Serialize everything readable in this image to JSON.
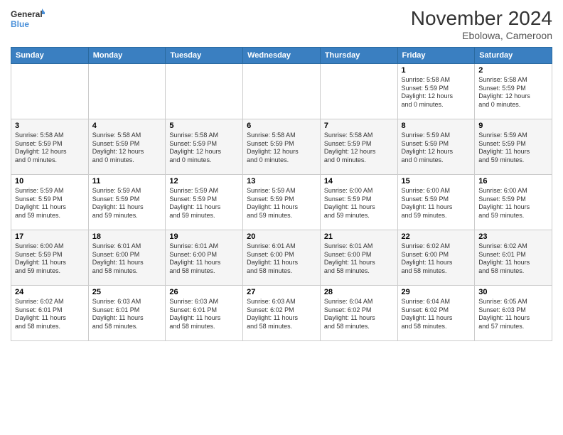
{
  "logo": {
    "line1": "General",
    "line2": "Blue"
  },
  "title": "November 2024",
  "subtitle": "Ebolowa, Cameroon",
  "days_header": [
    "Sunday",
    "Monday",
    "Tuesday",
    "Wednesday",
    "Thursday",
    "Friday",
    "Saturday"
  ],
  "weeks": [
    [
      {
        "day": "",
        "info": ""
      },
      {
        "day": "",
        "info": ""
      },
      {
        "day": "",
        "info": ""
      },
      {
        "day": "",
        "info": ""
      },
      {
        "day": "",
        "info": ""
      },
      {
        "day": "1",
        "info": "Sunrise: 5:58 AM\nSunset: 5:59 PM\nDaylight: 12 hours\nand 0 minutes."
      },
      {
        "day": "2",
        "info": "Sunrise: 5:58 AM\nSunset: 5:59 PM\nDaylight: 12 hours\nand 0 minutes."
      }
    ],
    [
      {
        "day": "3",
        "info": "Sunrise: 5:58 AM\nSunset: 5:59 PM\nDaylight: 12 hours\nand 0 minutes."
      },
      {
        "day": "4",
        "info": "Sunrise: 5:58 AM\nSunset: 5:59 PM\nDaylight: 12 hours\nand 0 minutes."
      },
      {
        "day": "5",
        "info": "Sunrise: 5:58 AM\nSunset: 5:59 PM\nDaylight: 12 hours\nand 0 minutes."
      },
      {
        "day": "6",
        "info": "Sunrise: 5:58 AM\nSunset: 5:59 PM\nDaylight: 12 hours\nand 0 minutes."
      },
      {
        "day": "7",
        "info": "Sunrise: 5:58 AM\nSunset: 5:59 PM\nDaylight: 12 hours\nand 0 minutes."
      },
      {
        "day": "8",
        "info": "Sunrise: 5:59 AM\nSunset: 5:59 PM\nDaylight: 12 hours\nand 0 minutes."
      },
      {
        "day": "9",
        "info": "Sunrise: 5:59 AM\nSunset: 5:59 PM\nDaylight: 11 hours\nand 59 minutes."
      }
    ],
    [
      {
        "day": "10",
        "info": "Sunrise: 5:59 AM\nSunset: 5:59 PM\nDaylight: 11 hours\nand 59 minutes."
      },
      {
        "day": "11",
        "info": "Sunrise: 5:59 AM\nSunset: 5:59 PM\nDaylight: 11 hours\nand 59 minutes."
      },
      {
        "day": "12",
        "info": "Sunrise: 5:59 AM\nSunset: 5:59 PM\nDaylight: 11 hours\nand 59 minutes."
      },
      {
        "day": "13",
        "info": "Sunrise: 5:59 AM\nSunset: 5:59 PM\nDaylight: 11 hours\nand 59 minutes."
      },
      {
        "day": "14",
        "info": "Sunrise: 6:00 AM\nSunset: 5:59 PM\nDaylight: 11 hours\nand 59 minutes."
      },
      {
        "day": "15",
        "info": "Sunrise: 6:00 AM\nSunset: 5:59 PM\nDaylight: 11 hours\nand 59 minutes."
      },
      {
        "day": "16",
        "info": "Sunrise: 6:00 AM\nSunset: 5:59 PM\nDaylight: 11 hours\nand 59 minutes."
      }
    ],
    [
      {
        "day": "17",
        "info": "Sunrise: 6:00 AM\nSunset: 5:59 PM\nDaylight: 11 hours\nand 59 minutes."
      },
      {
        "day": "18",
        "info": "Sunrise: 6:01 AM\nSunset: 6:00 PM\nDaylight: 11 hours\nand 58 minutes."
      },
      {
        "day": "19",
        "info": "Sunrise: 6:01 AM\nSunset: 6:00 PM\nDaylight: 11 hours\nand 58 minutes."
      },
      {
        "day": "20",
        "info": "Sunrise: 6:01 AM\nSunset: 6:00 PM\nDaylight: 11 hours\nand 58 minutes."
      },
      {
        "day": "21",
        "info": "Sunrise: 6:01 AM\nSunset: 6:00 PM\nDaylight: 11 hours\nand 58 minutes."
      },
      {
        "day": "22",
        "info": "Sunrise: 6:02 AM\nSunset: 6:00 PM\nDaylight: 11 hours\nand 58 minutes."
      },
      {
        "day": "23",
        "info": "Sunrise: 6:02 AM\nSunset: 6:01 PM\nDaylight: 11 hours\nand 58 minutes."
      }
    ],
    [
      {
        "day": "24",
        "info": "Sunrise: 6:02 AM\nSunset: 6:01 PM\nDaylight: 11 hours\nand 58 minutes."
      },
      {
        "day": "25",
        "info": "Sunrise: 6:03 AM\nSunset: 6:01 PM\nDaylight: 11 hours\nand 58 minutes."
      },
      {
        "day": "26",
        "info": "Sunrise: 6:03 AM\nSunset: 6:01 PM\nDaylight: 11 hours\nand 58 minutes."
      },
      {
        "day": "27",
        "info": "Sunrise: 6:03 AM\nSunset: 6:02 PM\nDaylight: 11 hours\nand 58 minutes."
      },
      {
        "day": "28",
        "info": "Sunrise: 6:04 AM\nSunset: 6:02 PM\nDaylight: 11 hours\nand 58 minutes."
      },
      {
        "day": "29",
        "info": "Sunrise: 6:04 AM\nSunset: 6:02 PM\nDaylight: 11 hours\nand 58 minutes."
      },
      {
        "day": "30",
        "info": "Sunrise: 6:05 AM\nSunset: 6:03 PM\nDaylight: 11 hours\nand 57 minutes."
      }
    ]
  ]
}
